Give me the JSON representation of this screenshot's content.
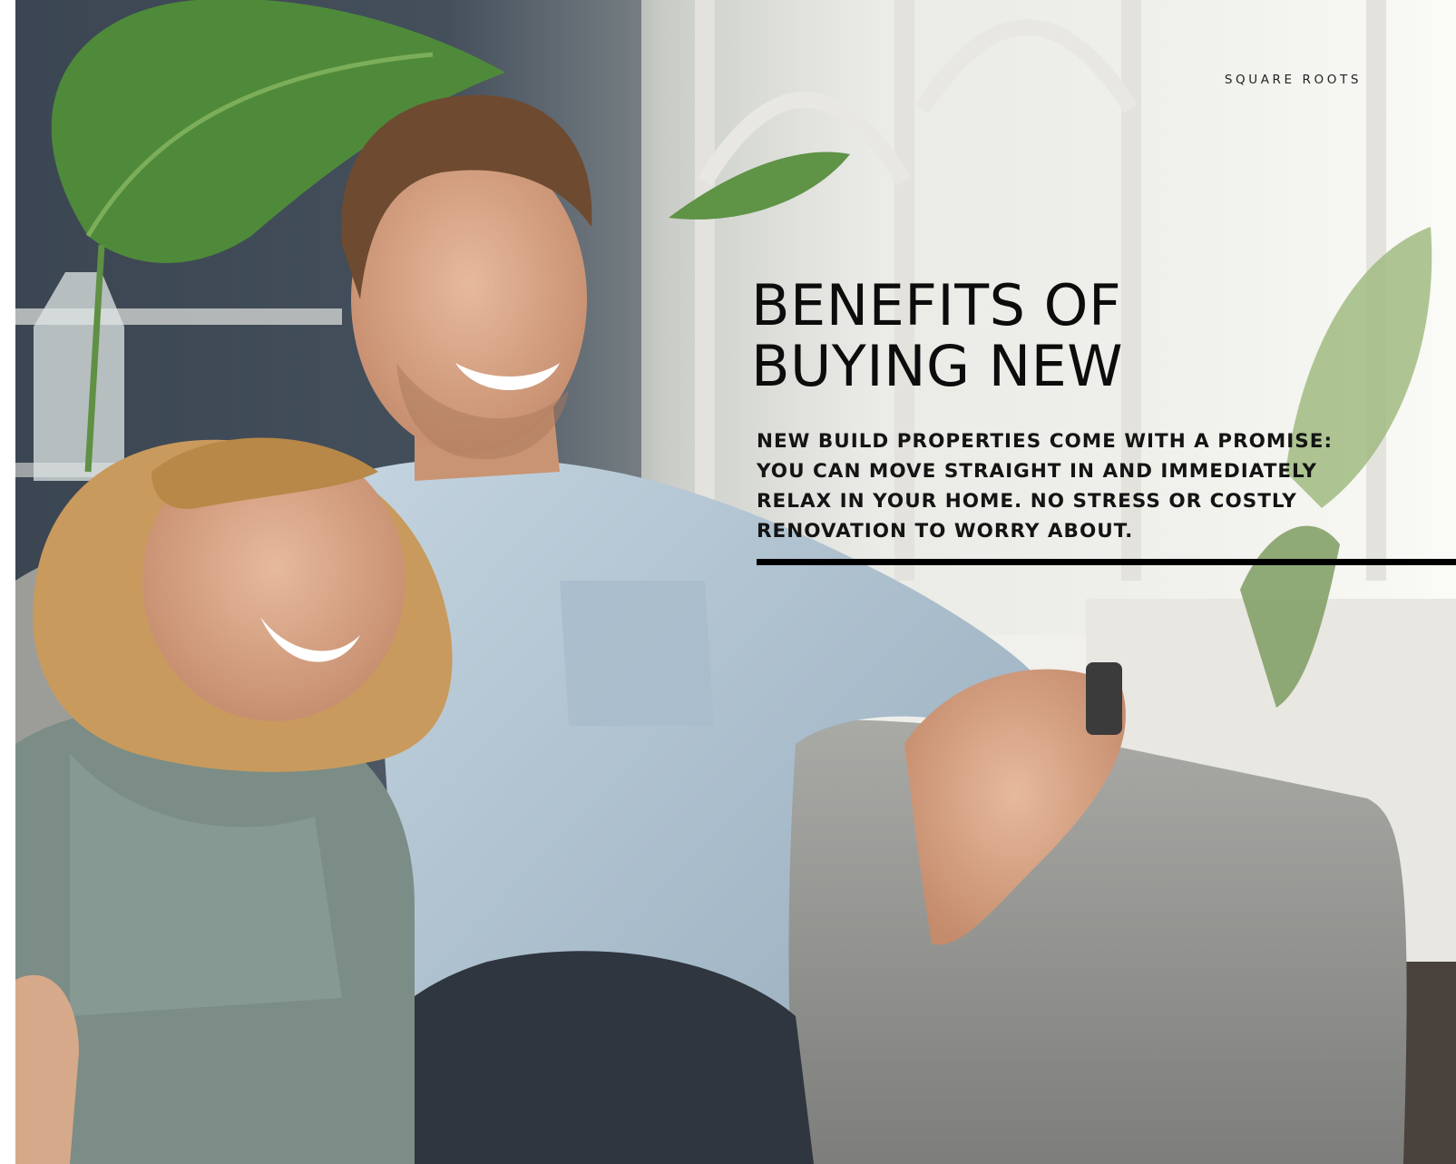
{
  "brand": "SQUARE ROOTS",
  "headline": {
    "line1": "BENEFITS OF",
    "line2": "BUYING NEW"
  },
  "intro": "NEW BUILD PROPERTIES COME WITH A PROMISE: YOU CAN MOVE STRAIGHT IN AND IMMEDIATELY RELAX IN YOUR HOME. NO STRESS OR COSTLY RENOVATION TO WORRY ABOUT.",
  "colors": {
    "text": "#0c0c0c",
    "rule": "#000000",
    "background": "#ffffff"
  }
}
